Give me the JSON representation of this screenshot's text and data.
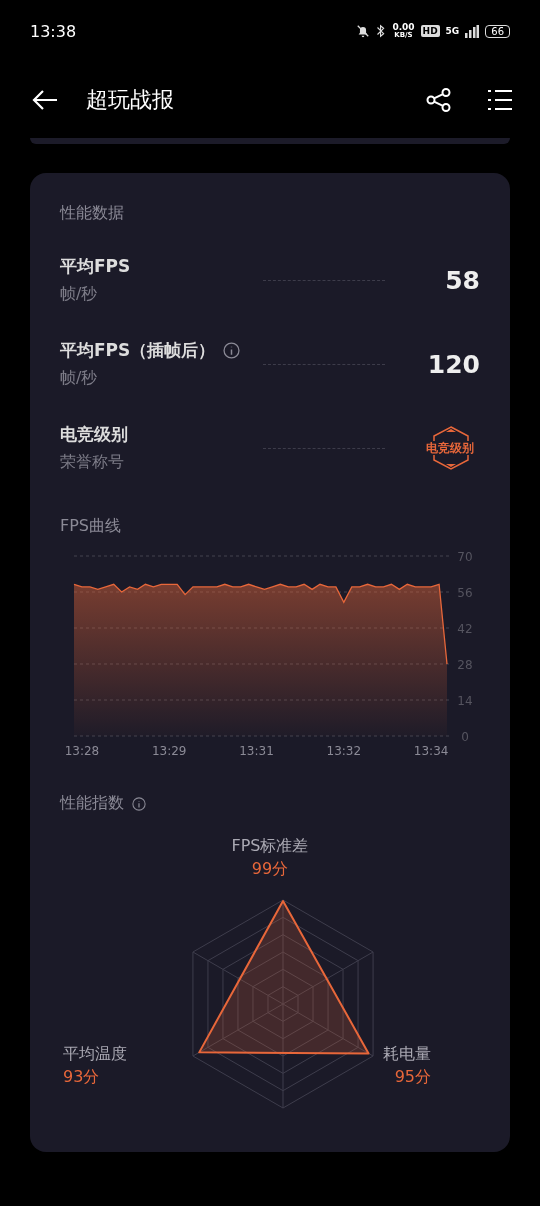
{
  "status_bar": {
    "time": "13:38",
    "net_speed": "0.00",
    "net_unit": "KB/S",
    "hd": "HD",
    "network": "5G",
    "battery": "66"
  },
  "header": {
    "title": "超玩战报"
  },
  "performance": {
    "title": "性能数据",
    "rows": [
      {
        "kind": "number",
        "label": "平均FPS",
        "info": false,
        "unit": "帧/秒",
        "value": "58"
      },
      {
        "kind": "number",
        "label": "平均FPS（插帧后）",
        "info": true,
        "unit": "帧/秒",
        "value": "120"
      },
      {
        "kind": "badge",
        "label": "电竞级别",
        "info": false,
        "unit": "荣誉称号",
        "value": "电竞级别"
      }
    ],
    "fps_chart": {
      "title": "FPS曲线",
      "chart_data": {
        "type": "area",
        "categories": [
          null,
          "13:28",
          null,
          null,
          null,
          null,
          null,
          null,
          null,
          null,
          null,
          null,
          "13:29",
          null,
          null,
          null,
          null,
          null,
          null,
          null,
          null,
          null,
          null,
          "13:31",
          null,
          null,
          null,
          null,
          null,
          null,
          null,
          null,
          null,
          null,
          "13:32",
          null,
          null,
          null,
          null,
          null,
          null,
          null,
          null,
          null,
          null,
          "13:34",
          null,
          null
        ],
        "series": [
          {
            "color": "#e8673a",
            "values": [
              59,
              58,
              58,
              57,
              58,
              59,
              56,
              58,
              57,
              59,
              58,
              59,
              59,
              59,
              55,
              58,
              58,
              58,
              58,
              59,
              58,
              58,
              59,
              58,
              57,
              58,
              59,
              58,
              58,
              59,
              57,
              59,
              58,
              58,
              52,
              58,
              58,
              59,
              58,
              58,
              59,
              57,
              59,
              58,
              58,
              58,
              59,
              28
            ]
          }
        ],
        "grid": true,
        "ylim": [
          0,
          70
        ],
        "yticks": [
          0,
          14,
          28,
          42,
          56,
          70
        ]
      }
    }
  },
  "index": {
    "title": "性能指数",
    "info": true,
    "metrics": [
      {
        "label": "FPS标准差",
        "score": "99分"
      },
      {
        "label": "平均温度",
        "score": "93分"
      },
      {
        "label": "耗电量",
        "score": "95分"
      }
    ]
  }
}
